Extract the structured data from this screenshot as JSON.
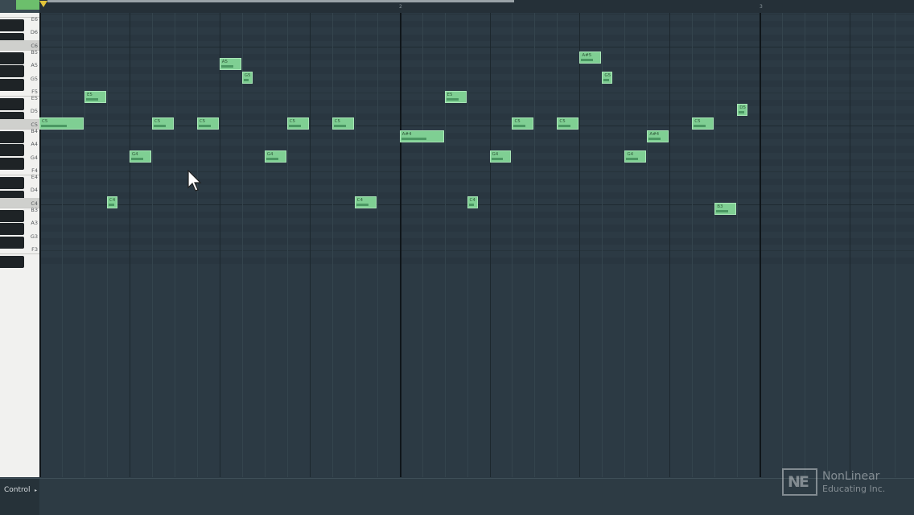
{
  "ruler": {
    "bar_markers": [
      "2",
      "3"
    ]
  },
  "keyboard": {
    "labels": [
      "E6",
      "D6",
      "C6",
      "B5",
      "A5",
      "G5",
      "F5",
      "E5",
      "D5",
      "C5",
      "B4",
      "A4",
      "G4",
      "F4",
      "E4",
      "D4",
      "C4",
      "B3",
      "A3",
      "G3",
      "F3"
    ]
  },
  "notes": [
    {
      "pitch": "C5",
      "start": 0,
      "length": 1
    },
    {
      "pitch": "E5",
      "start": 1,
      "length": 0.5
    },
    {
      "pitch": "C4",
      "start": 1.5,
      "length": 0.25
    },
    {
      "pitch": "G4",
      "start": 2,
      "length": 0.5
    },
    {
      "pitch": "C5",
      "start": 2.5,
      "length": 0.5
    },
    {
      "pitch": "C5",
      "start": 3.5,
      "length": 0.5
    },
    {
      "pitch": "A5",
      "start": 4,
      "length": 0.5
    },
    {
      "pitch": "G5",
      "start": 4.5,
      "length": 0.25
    },
    {
      "pitch": "G4",
      "start": 5,
      "length": 0.5
    },
    {
      "pitch": "C5",
      "start": 5.5,
      "length": 0.5
    },
    {
      "pitch": "C5",
      "start": 6.5,
      "length": 0.5
    },
    {
      "pitch": "C4",
      "start": 7,
      "length": 0.5
    },
    {
      "pitch": "A#4",
      "start": 8,
      "length": 1
    },
    {
      "pitch": "E5",
      "start": 9,
      "length": 0.5
    },
    {
      "pitch": "C4",
      "start": 9.5,
      "length": 0.25
    },
    {
      "pitch": "G4",
      "start": 10,
      "length": 0.5
    },
    {
      "pitch": "C5",
      "start": 10.5,
      "length": 0.5
    },
    {
      "pitch": "C5",
      "start": 11.5,
      "length": 0.5
    },
    {
      "pitch": "A#5",
      "start": 12,
      "length": 0.5
    },
    {
      "pitch": "G5",
      "start": 12.5,
      "length": 0.25
    },
    {
      "pitch": "G4",
      "start": 13,
      "length": 0.5
    },
    {
      "pitch": "A#4",
      "start": 13.5,
      "length": 0.5
    },
    {
      "pitch": "C5",
      "start": 14.5,
      "length": 0.5
    },
    {
      "pitch": "B3",
      "start": 15,
      "length": 0.5
    },
    {
      "pitch": "D5",
      "start": 15.5,
      "length": 0.25
    }
  ],
  "control": {
    "label": "Control",
    "arrow": "▸"
  },
  "watermark": {
    "logo": "NE",
    "line1": "NonLinear",
    "line2": "Educating Inc."
  },
  "colors": {
    "note": "#7fcf93",
    "grid_bg": "#2c3a44",
    "playhead": "#e2c33a"
  }
}
